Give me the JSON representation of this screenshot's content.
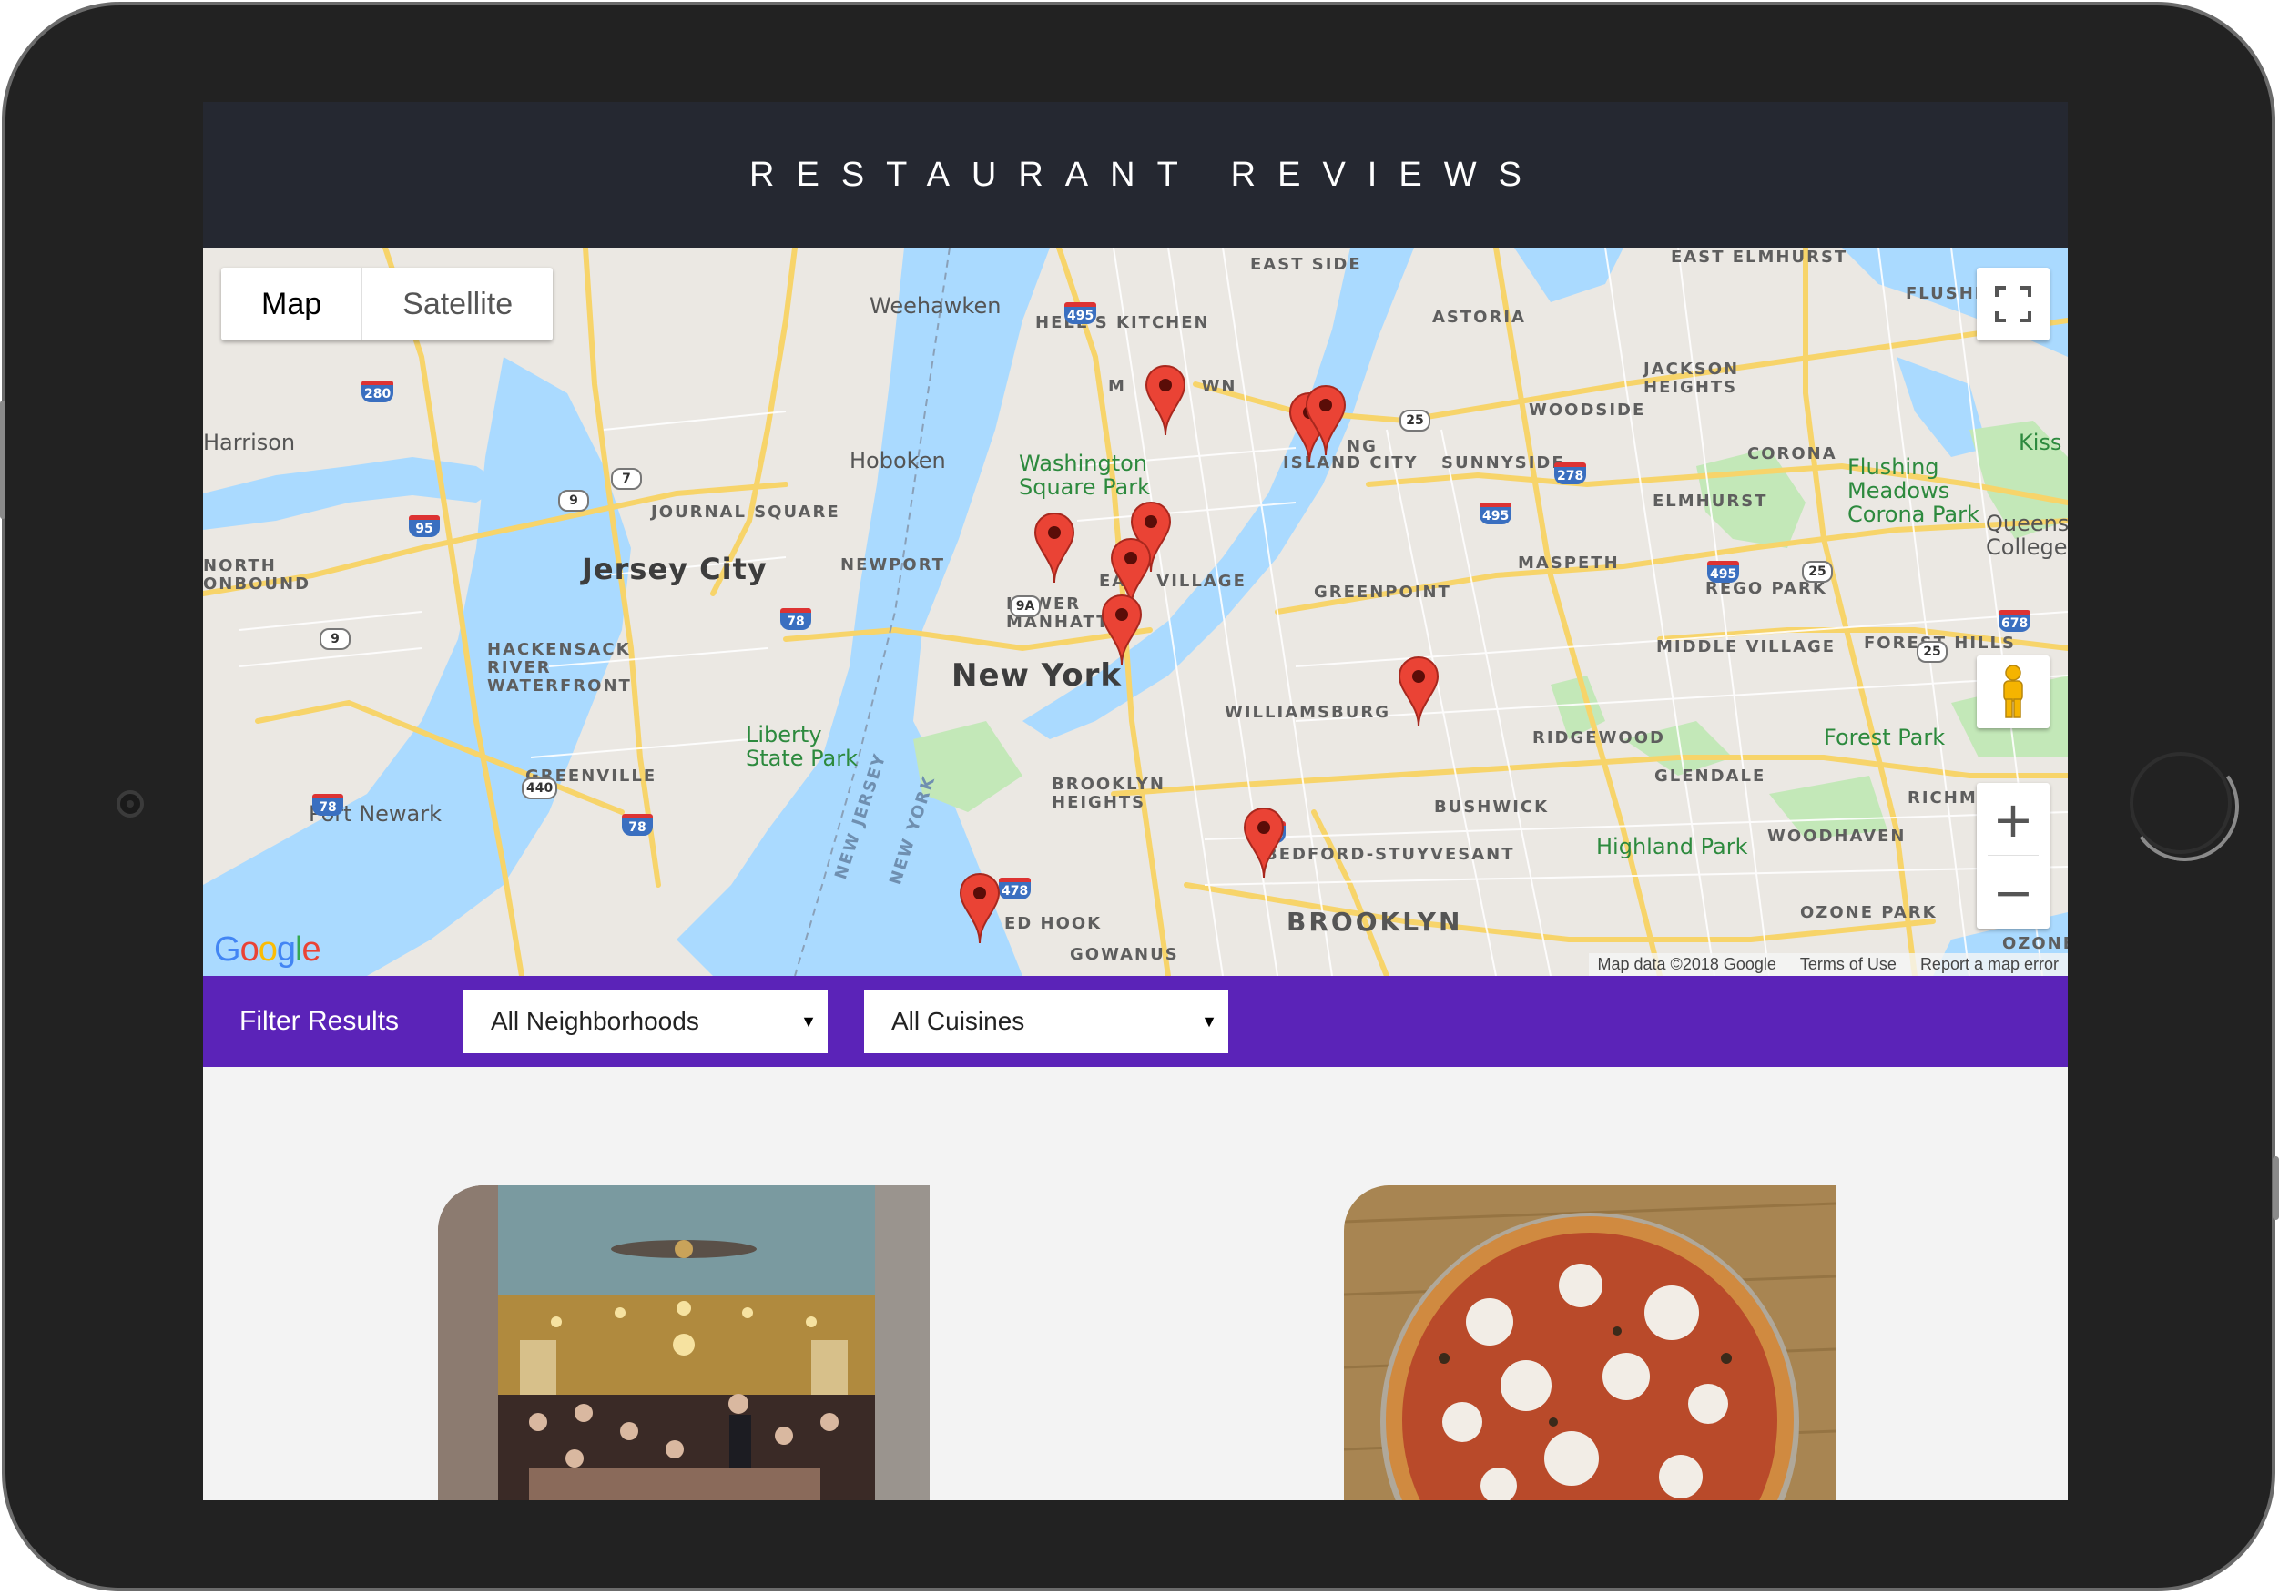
{
  "header": {
    "title": "RESTAURANT REVIEWS"
  },
  "map": {
    "type_buttons": {
      "map": "Map",
      "satellite": "Satellite"
    },
    "attribution": {
      "data": "Map data ©2018 Google",
      "terms": "Terms of Use",
      "report": "Report a map error"
    },
    "google_logo": "Google",
    "zoom_in": "+",
    "zoom_out": "−",
    "labels": {
      "east_side": "EAST SIDE",
      "east_elmhurst": "EAST ELMHURST",
      "weehawken": "Weehawken",
      "hells_kitchen": "HELL'S KITCHEN",
      "astoria": "ASTORIA",
      "flushing": "FLUSHI",
      "jackson_heights": "JACKSON\nHEIGHTS",
      "harrison": "Harrison",
      "woodside": "WOODSIDE",
      "kiss": "Kiss",
      "hoboken": "Hoboken",
      "washington_square_park": "Washington\nSquare Park",
      "island_city": "ISLAND CITY",
      "sunnyside": "SUNNYSIDE",
      "corona": "CORONA",
      "flushing_meadows": "Flushing\nMeadows\nCorona Park",
      "queens_college": "Queens\nCollege",
      "journal_square": "JOURNAL SQUARE",
      "elmhurst": "ELMHURST",
      "north_bound": "NORTH\nONBOUND",
      "jersey_city": "Jersey City",
      "newport": "NEWPORT",
      "maspeth": "MASPETH",
      "rego_park": "REGO PARK",
      "east_village": "EA    VILLAGE",
      "greenpoint": "GREENPOINT",
      "lower_manhattan": "LOWER\nMANHATT",
      "hackensack": "HACKENSACK\nRIVER\nWATERFRONT",
      "middle_village": "MIDDLE VILLAGE",
      "forest_hills": "FOREST HILLS",
      "new_york": "New York",
      "williamsburg": "WILLIAMSBURG",
      "ridgewood": "RIDGEWOOD",
      "forest_park": "Forest Park",
      "liberty_state_park": "Liberty\nState Park",
      "greenville": "GREENVILLE",
      "glendale": "GLENDALE",
      "brooklyn_heights": "BROOKLYN\nHEIGHTS",
      "richmond": "RICHM",
      "port_newark": "Port Newark",
      "bushwick": "BUSHWICK",
      "new_jersey": "NEW JERSEY",
      "new_york_water": "NEW YORK",
      "highland_park": "Highland Park",
      "woodhaven": "WOODHAVEN",
      "bedford": "BEDFORD-STUYVESANT",
      "red_hook": "ED HOOK",
      "ozone_park": "OZONE PARK",
      "brooklyn": "BROOKLYN",
      "gowanus": "GOWANUS",
      "ozone": "OZONE",
      "midtown": "M          WN",
      "long": "NG"
    },
    "shields": [
      "495",
      "280",
      "7",
      "9",
      "95",
      "9A",
      "78",
      "9",
      "440",
      "78",
      "78",
      "478",
      "278",
      "25",
      "278",
      "495",
      "495",
      "25",
      "678",
      "25"
    ]
  },
  "filter": {
    "label": "Filter Results",
    "neighborhoods": {
      "selected": "All Neighborhoods"
    },
    "cuisines": {
      "selected": "All Cuisines"
    }
  },
  "colors": {
    "header_bg": "#252831",
    "filter_bg": "#5b23b8",
    "marker": "#ea4335"
  }
}
